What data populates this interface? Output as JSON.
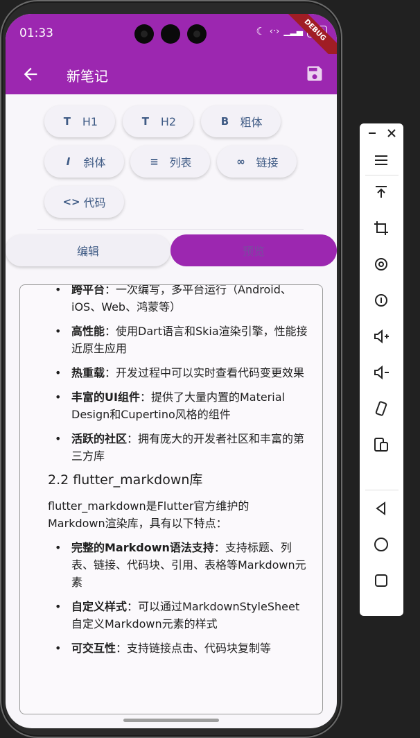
{
  "status_bar": {
    "time": "01:33",
    "battery": "100",
    "debug_label": "DEBUG"
  },
  "app_bar": {
    "title": "新笔记"
  },
  "toolbar": {
    "chips": [
      {
        "icon": "T",
        "label": "H1"
      },
      {
        "icon": "T",
        "label": "H2"
      },
      {
        "icon": "B",
        "label": "粗体"
      },
      {
        "icon": "I",
        "label": "斜体"
      },
      {
        "icon": "≡",
        "label": "列表"
      },
      {
        "icon": "∞",
        "label": "链接"
      },
      {
        "icon": "<>",
        "label": "代码"
      }
    ]
  },
  "tabs": {
    "edit": "编辑",
    "preview": "预览"
  },
  "preview": {
    "top_item": {
      "bold": "跨平台",
      "text": "：一次编写，多平台运行（Android、iOS、Web、鸿蒙等）"
    },
    "items1": [
      {
        "bold": "高性能",
        "text": "：使用Dart语言和Skia渲染引擎，性能接近原生应用"
      },
      {
        "bold": "热重载",
        "text": "：开发过程中可以实时查看代码变更效果"
      },
      {
        "bold": "丰富的UI组件",
        "text": "：提供了大量内置的Material Design和Cupertino风格的组件"
      },
      {
        "bold": "活跃的社区",
        "text": "：拥有庞大的开发者社区和丰富的第三方库"
      }
    ],
    "heading": "2.2 flutter_markdown库",
    "paragraph": "flutter_markdown是Flutter官方维护的Markdown渲染库，具有以下特点：",
    "items2": [
      {
        "bold": "完整的Markdown语法支持",
        "text": "：支持标题、列表、链接、代码块、引用、表格等Markdown元素"
      },
      {
        "bold": "自定义样式",
        "text": "：可以通过MarkdownStyleSheet自定义Markdown元素的样式"
      },
      {
        "bold": "可交互性",
        "text": "：支持链接点击、代码块复制等"
      }
    ]
  }
}
